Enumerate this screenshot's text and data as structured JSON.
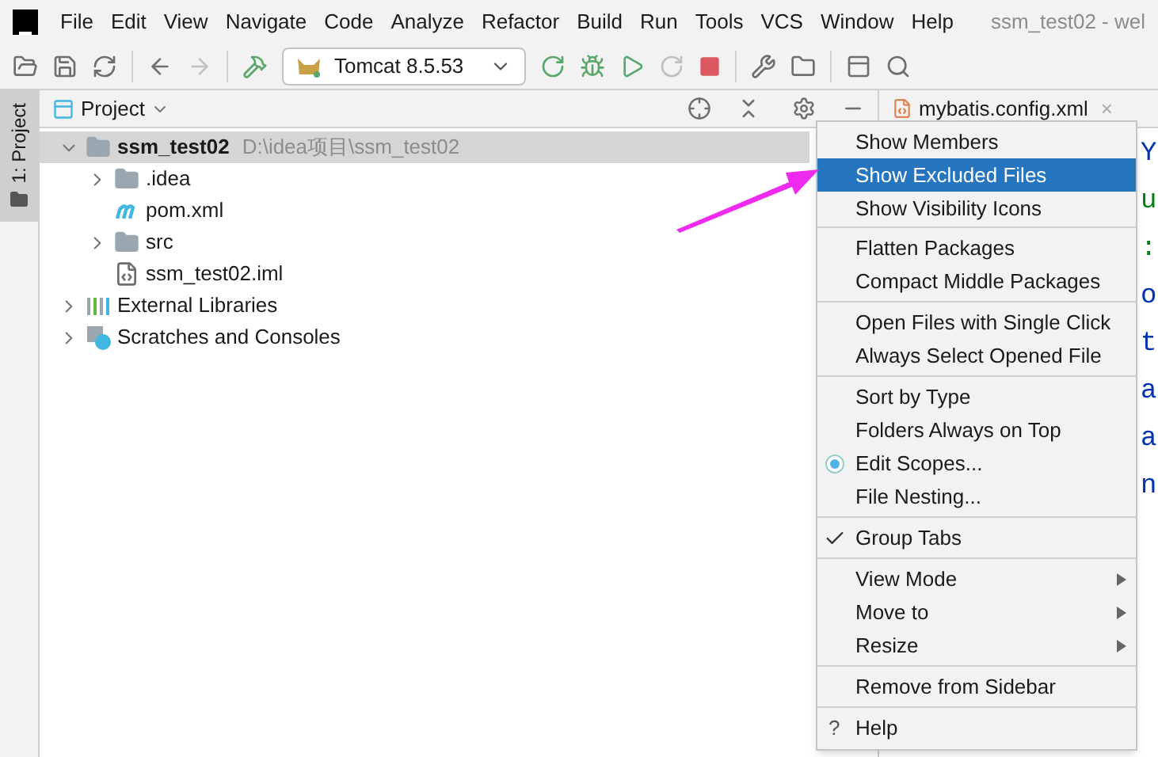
{
  "window": {
    "title": "ssm_test02 - wel"
  },
  "menu_bar": [
    "File",
    "Edit",
    "View",
    "Navigate",
    "Code",
    "Analyze",
    "Refactor",
    "Build",
    "Run",
    "Tools",
    "VCS",
    "Window",
    "Help"
  ],
  "toolbar": {
    "run_config": "Tomcat 8.5.53"
  },
  "side_tab": {
    "label": "1: Project",
    "selected": true
  },
  "project_panel": {
    "title": "Project",
    "tree": [
      {
        "name": "ssm_test02",
        "path": "D:\\idea项目\\ssm_test02",
        "kind": "module",
        "expanded": true,
        "selected": true,
        "children": [
          {
            "name": ".idea",
            "kind": "folder",
            "expanded": false
          },
          {
            "name": "pom.xml",
            "kind": "maven"
          },
          {
            "name": "src",
            "kind": "folder",
            "expanded": false
          },
          {
            "name": "ssm_test02.iml",
            "kind": "iml"
          }
        ]
      },
      {
        "name": "External Libraries",
        "kind": "libraries",
        "expanded": false
      },
      {
        "name": "Scratches and Consoles",
        "kind": "scratches",
        "expanded": false
      }
    ]
  },
  "editor": {
    "tab": {
      "label": "mybatis.config.xml",
      "close": "×"
    },
    "lines": [
      {
        "text": "Y",
        "color": "#0033b3"
      },
      {
        "text": "u",
        "color": "#067d17"
      },
      {
        "text": ":",
        "color": "#067d17"
      },
      {
        "text": "o",
        "color": "#0033b3"
      },
      {
        "text": "t",
        "color": "#0033b3"
      },
      {
        "text": "a",
        "color": "#0033b3"
      },
      {
        "text": "a",
        "color": "#0033b3"
      },
      {
        "text": "n",
        "color": "#0033b3"
      }
    ]
  },
  "context_menu": [
    [
      {
        "label": "Show Members",
        "selected": false,
        "checked": false,
        "submenu": false,
        "kind": "item"
      },
      {
        "label": "Show Excluded Files",
        "selected": true,
        "checked": false,
        "submenu": false,
        "kind": "item"
      },
      {
        "label": "Show Visibility Icons",
        "selected": false,
        "checked": false,
        "submenu": false,
        "kind": "item"
      }
    ],
    [
      {
        "label": "Flatten Packages",
        "selected": false,
        "checked": false,
        "submenu": false,
        "kind": "item"
      },
      {
        "label": "Compact Middle Packages",
        "selected": false,
        "checked": false,
        "submenu": false,
        "kind": "item"
      }
    ],
    [
      {
        "label": "Open Files with Single Click",
        "selected": false,
        "checked": false,
        "submenu": false,
        "kind": "item"
      },
      {
        "label": "Always Select Opened File",
        "selected": false,
        "checked": false,
        "submenu": false,
        "kind": "item"
      }
    ],
    [
      {
        "label": "Sort by Type",
        "selected": false,
        "checked": false,
        "submenu": false,
        "kind": "item"
      },
      {
        "label": "Folders Always on Top",
        "selected": false,
        "checked": false,
        "submenu": false,
        "kind": "item"
      },
      {
        "label": "Edit Scopes...",
        "selected": false,
        "checked": false,
        "submenu": false,
        "kind": "scopes"
      },
      {
        "label": "File Nesting...",
        "selected": false,
        "checked": false,
        "submenu": false,
        "kind": "item"
      }
    ],
    [
      {
        "label": "Group Tabs",
        "selected": false,
        "checked": true,
        "submenu": false,
        "kind": "item"
      }
    ],
    [
      {
        "label": "View Mode",
        "selected": false,
        "checked": false,
        "submenu": true,
        "kind": "item"
      },
      {
        "label": "Move to",
        "selected": false,
        "checked": false,
        "submenu": true,
        "kind": "item"
      },
      {
        "label": "Resize",
        "selected": false,
        "checked": false,
        "submenu": true,
        "kind": "item"
      }
    ],
    [
      {
        "label": "Remove from Sidebar",
        "selected": false,
        "checked": false,
        "submenu": false,
        "kind": "item"
      }
    ],
    [
      {
        "label": "Help",
        "selected": false,
        "checked": false,
        "submenu": false,
        "kind": "help",
        "icon_text": "?"
      }
    ]
  ]
}
